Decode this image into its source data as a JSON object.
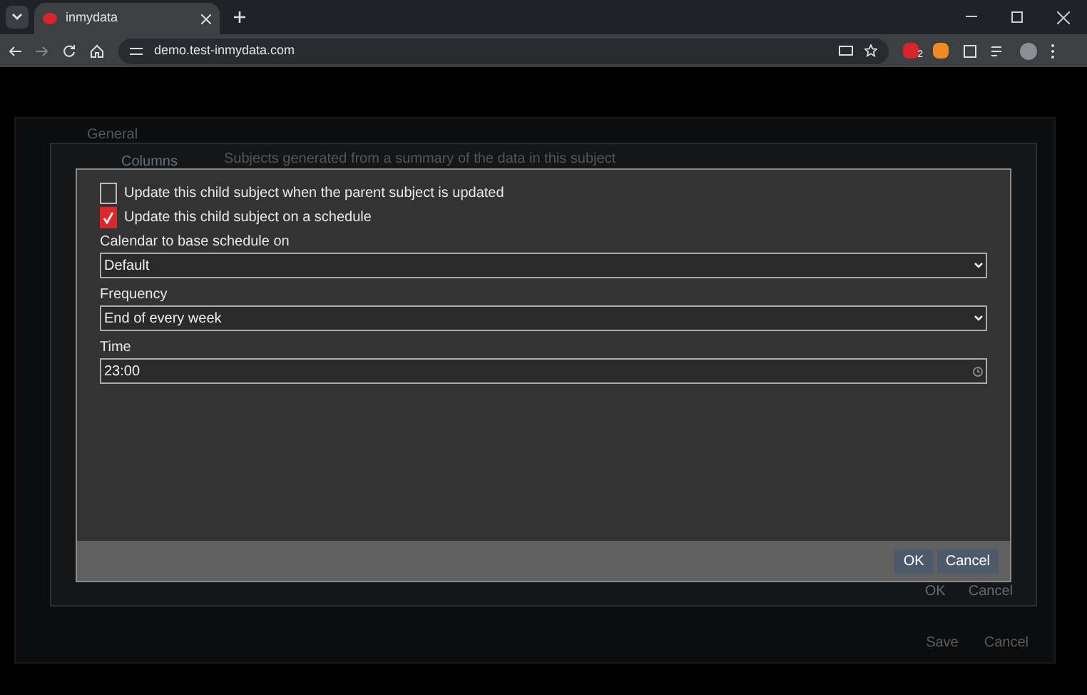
{
  "browser": {
    "tab_title": "inmydata",
    "url": "demo.test-inmydata.com",
    "extension_badge": "2"
  },
  "background": {
    "tabs": [
      {
        "label": "General",
        "selected": false
      },
      {
        "label": "Columns",
        "selected": true
      }
    ],
    "description": "Subjects generated from a summary of the data in this subject",
    "inner_buttons": [
      "OK",
      "Cancel"
    ],
    "outer_buttons": [
      "Save",
      "Cancel"
    ]
  },
  "modal": {
    "options": [
      {
        "label": "Update this child subject when the parent subject is updated",
        "checked": false
      },
      {
        "label": "Update this child subject on a schedule",
        "checked": true
      }
    ],
    "fields": [
      {
        "label": "Calendar to base schedule on",
        "kind": "select",
        "value": "Default"
      },
      {
        "label": "Frequency",
        "kind": "select",
        "value": "End of every week"
      },
      {
        "label": "Time",
        "kind": "time",
        "value": "23:00"
      }
    ],
    "buttons": [
      "OK",
      "Cancel"
    ]
  }
}
